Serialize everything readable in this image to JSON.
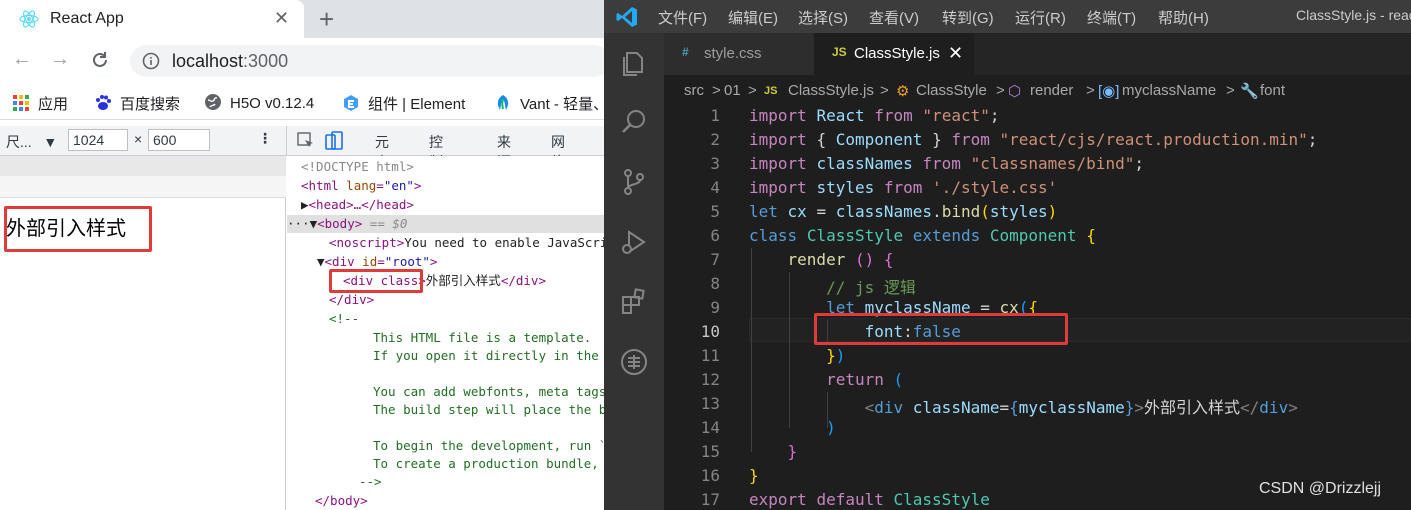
{
  "browser": {
    "tab_title": "React App",
    "tab_close": "✕",
    "new_tab": "+",
    "url_host": "localhost",
    "url_port": ":3000",
    "bookmarks": [
      {
        "label": "应用",
        "icon": "apps-grid-icon"
      },
      {
        "label": "百度搜索",
        "icon": "baidu-paw-icon"
      },
      {
        "label": "H5O v0.12.4",
        "icon": "globe-icon"
      },
      {
        "label": "组件 | Element",
        "icon": "element-shield-icon"
      },
      {
        "label": "Vant - 轻量、",
        "icon": "vant-logo-icon"
      }
    ],
    "device_toolbar": {
      "size_label": "尺...",
      "dropdown_arrow": "▼",
      "width": "1024",
      "times": "×",
      "height": "600",
      "more": "⋮"
    },
    "devtools_tabs": [
      "元素",
      "控制台",
      "来源",
      "网络"
    ],
    "page_text": "外部引入样式",
    "elements_tree": {
      "doctype": "<!DOCTYPE html>",
      "html_open": "<html",
      "html_attr": "lang",
      "html_val": "\"en\"",
      "head": "<head>…</head>",
      "body": "<body>",
      "body_eq": " == $0",
      "noscript_tag": "<noscript>",
      "noscript_text": "You need to enable JavaScript",
      "div_root_open": "<div",
      "div_root_attr": "id",
      "div_root_val": "\"root\"",
      "inner_div": "<div class>",
      "inner_text": "外部引入样式",
      "inner_close": "</div>",
      "div_close": "</div>",
      "comment_open": "<!--",
      "comment_lines": [
        "This HTML file is a template.",
        "If you open it directly in the b",
        "",
        "You can add webfonts, meta tags",
        "The build step will place the bu",
        "",
        "To begin the development, run `n",
        "To create a production bundle, u"
      ],
      "comment_close": "-->",
      "body_close": "</body>"
    }
  },
  "vscode": {
    "menus": [
      "文件(F)",
      "编辑(E)",
      "选择(S)",
      "查看(V)",
      "转到(G)",
      "运行(R)",
      "终端(T)",
      "帮助(H)"
    ],
    "window_title": "ClassStyle.js - react",
    "tabs": [
      {
        "icon": "#",
        "name": "style.css",
        "active": false
      },
      {
        "icon": "JS",
        "name": "ClassStyle.js",
        "active": true,
        "close": "✕"
      }
    ],
    "breadcrumbs": [
      "src",
      "01",
      "ClassStyle.js",
      "ClassStyle",
      "render",
      "myclassName",
      "font"
    ],
    "breadcrumb_sep": ">",
    "line_numbers": [
      "1",
      "2",
      "3",
      "4",
      "5",
      "6",
      "7",
      "8",
      "9",
      "10",
      "11",
      "12",
      "13",
      "14",
      "15",
      "16",
      "17"
    ],
    "current_line": "10",
    "code": {
      "l1": {
        "kw": "import",
        "name": "React",
        "from": "from",
        "str": "\"react\"",
        "end": ";"
      },
      "l2": {
        "kw": "import",
        "open": "{",
        "name": "Component",
        "close": "}",
        "from": "from",
        "str": "\"react/cjs/react.production.min\"",
        "end": ";"
      },
      "l3": {
        "kw": "import",
        "name": "classNames",
        "from": "from",
        "str": "\"classnames/bind\"",
        "end": ";"
      },
      "l4": {
        "kw": "import",
        "name": "styles",
        "from": "from",
        "str": "'./style.css'"
      },
      "l5": {
        "kw": "let",
        "name": "cx",
        "eq": "=",
        "obj": "classNames",
        "dot": ".",
        "fn": "bind",
        "open": "(",
        "arg": "styles",
        "close": ")"
      },
      "l6": {
        "kw": "class",
        "name": "ClassStyle",
        "ext": "extends",
        "base": "Component",
        "open": "{"
      },
      "l7": {
        "fn": "render",
        "paren": "()",
        "open": "{"
      },
      "l8": {
        "comment": "// js 逻辑"
      },
      "l9": {
        "kw": "let",
        "name": "myclassName",
        "eq": "=",
        "fn": "cx",
        "open": "(",
        "brace": "{"
      },
      "l10": {
        "key": "font",
        "colon": ":",
        "val": "false"
      },
      "l11": {
        "brace": "}",
        "close": ")"
      },
      "l12": {
        "kw": "return",
        "open": "("
      },
      "l13": {
        "lt": "<",
        "tag": "div",
        "attr": "className",
        "eq": "=",
        "jopen": "{",
        "jval": "myclassName",
        "jclose": "}",
        "gt": ">",
        "text": "外部引入样式",
        "closetag": "</",
        "closename": "div",
        "closegt": ">"
      },
      "l14": {
        "close": ")"
      },
      "l15": {
        "brace": "}"
      },
      "l16": {
        "brace": "}"
      },
      "l17": {
        "kw": "export",
        "kw2": "default",
        "name": "ClassStyle"
      }
    },
    "watermark": "CSDN @Drizzlejj"
  },
  "colors": {
    "highlight_box": "#e03b3b",
    "vscode_bg": "#1e1e1e",
    "vscode_keyword": "#569cd6",
    "vscode_string": "#ce9178",
    "vscode_class": "#4ec9b0"
  }
}
